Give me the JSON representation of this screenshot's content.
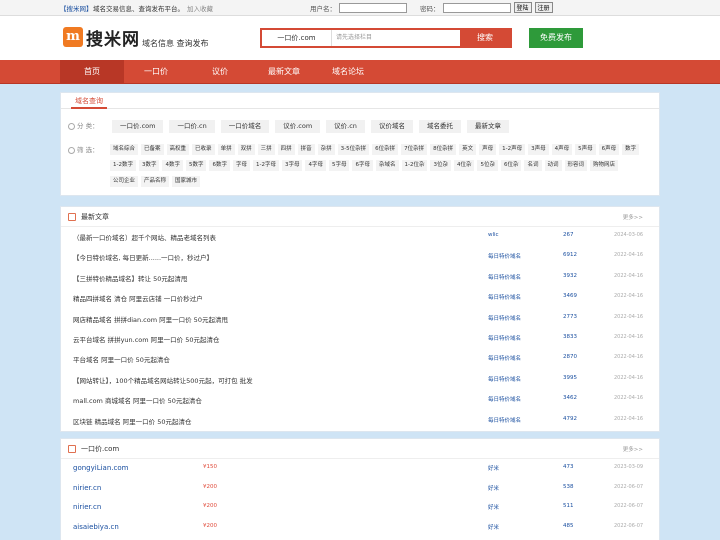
{
  "topbar": {
    "brand": "【搜米网】",
    "slogan": "域名交易信息、查询发布平台。",
    "favorite": "加入收藏",
    "username_label": "用户名：",
    "password_label": "密码：",
    "login_label": "登陆",
    "register_label": "注册"
  },
  "header": {
    "logo_text": "搜米网",
    "logo_sub": "域名信息 查询发布",
    "search_type": "一口价.com",
    "search_placeholder": "请先选择栏目",
    "search_button": "搜索",
    "publish_button": "免费发布"
  },
  "nav": [
    "首页",
    "一口价",
    "议价",
    "最新文章",
    "域名论坛"
  ],
  "domain_query": {
    "tab": "域名查询",
    "category_label": "分 类：",
    "categories": [
      "一口价.com",
      "一口价.cn",
      "一口价域名",
      "议价.com",
      "议价.cn",
      "议价域名",
      "域名委托",
      "最新文章"
    ],
    "filter_label": "筛 选：",
    "filters": [
      "域名综合",
      "已备案",
      "高权重",
      "已收录",
      "单拼",
      "双拼",
      "三拼",
      "四拼",
      "拼音",
      "杂拼",
      "3-5位杂拼",
      "6位杂拼",
      "7位杂拼",
      "8位杂拼",
      "英文",
      "声母",
      "1-2声母",
      "3声母",
      "4声母",
      "5声母",
      "6声母",
      "数字",
      "1-2数字",
      "3数字",
      "4数字",
      "5数字",
      "6数字",
      "字母",
      "1-2字母",
      "3字母",
      "4字母",
      "5字母",
      "6字母",
      "杂域名",
      "1-2位杂",
      "3位杂",
      "4位杂",
      "5位杂",
      "6位杂",
      "名词",
      "动词",
      "形容词",
      "购物网店",
      "公司企业",
      "产品名称",
      "国家城市"
    ]
  },
  "articles": {
    "title": "最新文章",
    "more": "更多>>",
    "rows": [
      {
        "title": "（最新一口价域名）超千个网站、精品老域名列表",
        "category": "wlic",
        "count": "267",
        "date": "2024-03-06"
      },
      {
        "title": "【今日特价域名, 每日更新......一口价，秒过户】",
        "category": "每日特价域名",
        "count": "6912",
        "date": "2022-04-16"
      },
      {
        "title": "【三拼特价精品域名】转让 50元起清甩",
        "category": "每日特价域名",
        "count": "3932",
        "date": "2022-04-16"
      },
      {
        "title": "精品四拼域名 清仓 阿里云店铺 一口价秒过户",
        "category": "每日特价域名",
        "count": "3469",
        "date": "2022-04-16"
      },
      {
        "title": "网店精品域名 拼拼dian.com 阿里一口价 50元起清甩",
        "category": "每日特价域名",
        "count": "2773",
        "date": "2022-04-16"
      },
      {
        "title": "云平台域名 拼拼yun.com 阿里一口价 50元起清仓",
        "category": "每日特价域名",
        "count": "3833",
        "date": "2022-04-16"
      },
      {
        "title": "平台域名 阿里一口价 50元起清仓",
        "category": "每日特价域名",
        "count": "2870",
        "date": "2022-04-16"
      },
      {
        "title": "【网站转让】，100个精品域名网站转让500元起，可打包 批发",
        "category": "每日特价域名",
        "count": "3995",
        "date": "2022-04-16"
      },
      {
        "title": "mall.com 商城域名 阿里一口价 50元起清仓",
        "category": "每日特价域名",
        "count": "3462",
        "date": "2022-04-16"
      },
      {
        "title": "区块链 精品域名 阿里一口价 50元起清仓",
        "category": "每日特价域名",
        "count": "4792",
        "date": "2022-04-16"
      }
    ]
  },
  "fixed_price_com": {
    "title": "一口价.com",
    "more": "更多>>",
    "rows": [
      {
        "domain": "gongyiLian.com",
        "price": "¥150",
        "seller": "好米",
        "count": "473",
        "date": "2023-03-09"
      },
      {
        "domain": "nirier.cn",
        "price": "¥200",
        "seller": "好米",
        "count": "538",
        "date": "2022-06-07"
      },
      {
        "domain": "nirier.cn",
        "price": "¥200",
        "seller": "好米",
        "count": "511",
        "date": "2022-06-07"
      },
      {
        "domain": "aisaiebiya.cn",
        "price": "¥200",
        "seller": "好米",
        "count": "485",
        "date": "2022-06-07"
      }
    ]
  }
}
